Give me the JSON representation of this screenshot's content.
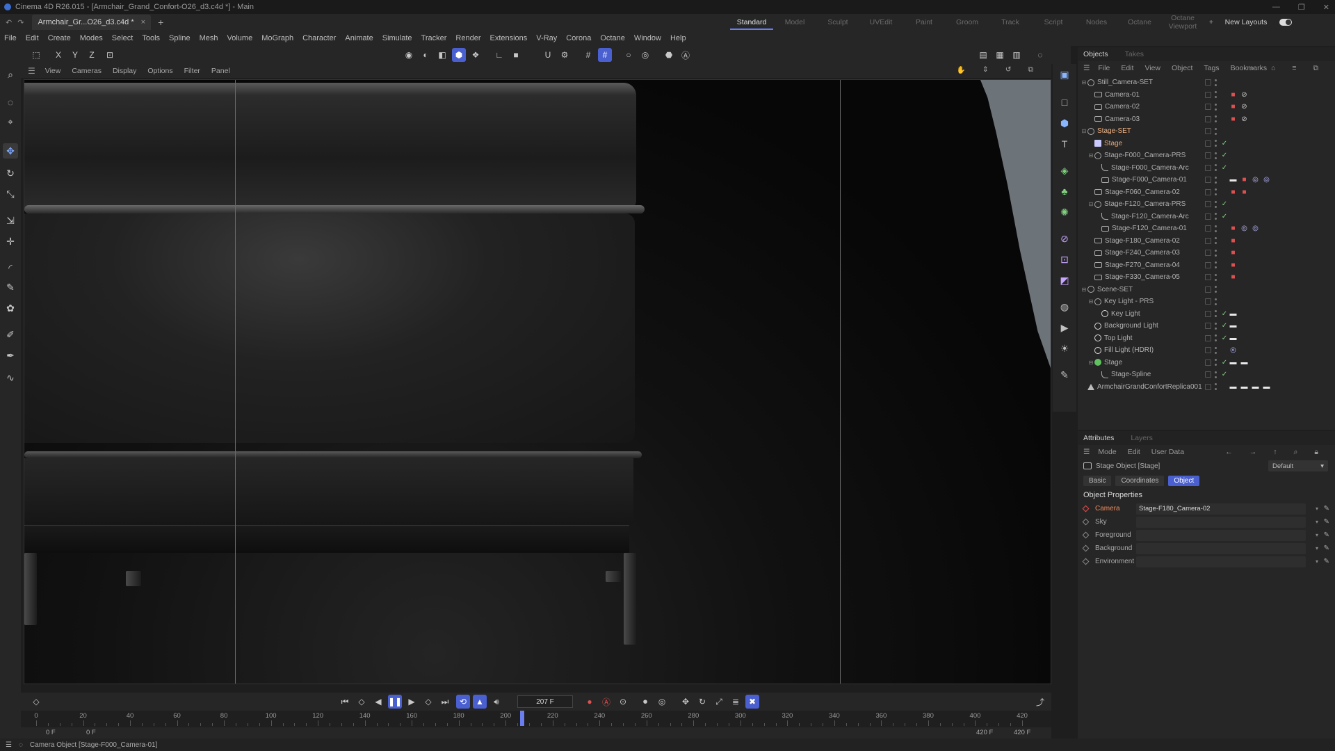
{
  "titlebar": {
    "title": "Cinema 4D R26.015 - [Armchair_Grand_Confort-O26_d3.c4d *] - Main",
    "controls": [
      "—",
      "❐",
      "✕"
    ]
  },
  "doc_tab": {
    "label": "Armchair_Gr...O26_d3.c4d *",
    "close": "×",
    "add": "+"
  },
  "layouts": {
    "items": [
      "Standard",
      "Model",
      "Sculpt",
      "UVEdit",
      "Paint",
      "Groom",
      "Track",
      "Script",
      "Nodes",
      "Octane",
      "Octane Viewport"
    ],
    "active": "Standard",
    "add": "+",
    "new_layouts": "New Layouts"
  },
  "menubar": [
    "File",
    "Edit",
    "Create",
    "Modes",
    "Select",
    "Tools",
    "Spline",
    "Mesh",
    "Volume",
    "MoGraph",
    "Character",
    "Animate",
    "Simulate",
    "Tracker",
    "Render",
    "Extensions",
    "V-Ray",
    "Corona",
    "Octane",
    "Window",
    "Help"
  ],
  "toolbar": {
    "axes": [
      "X",
      "Y",
      "Z"
    ]
  },
  "viewport_menu": [
    "View",
    "Cameras",
    "Display",
    "Options",
    "Filter",
    "Panel"
  ],
  "objects_panel": {
    "tabs": [
      "Objects",
      "Takes"
    ],
    "menu": [
      "File",
      "Edit",
      "View",
      "Object",
      "Tags",
      "Bookmarks"
    ],
    "rows": [
      {
        "label": "Still_Camera-SET",
        "icon": "null-icon",
        "indent": 0,
        "tw": "⊟",
        "check": false,
        "tags": []
      },
      {
        "label": "Camera-01",
        "icon": "camera-icon",
        "indent": 1,
        "tw": "",
        "check": false,
        "tags": [
          "rec",
          "no"
        ]
      },
      {
        "label": "Camera-02",
        "icon": "camera-icon",
        "indent": 1,
        "tw": "",
        "check": false,
        "tags": [
          "rec",
          "no"
        ]
      },
      {
        "label": "Camera-03",
        "icon": "camera-icon",
        "indent": 1,
        "tw": "",
        "check": false,
        "tags": [
          "rec",
          "no"
        ]
      },
      {
        "label": "Stage-SET",
        "icon": "null-icon",
        "indent": 0,
        "tw": "⊟",
        "check": false,
        "tags": [],
        "style": "hl"
      },
      {
        "label": "Stage",
        "icon": "stage-icon",
        "indent": 1,
        "tw": "",
        "check": true,
        "tags": [],
        "style": "sel"
      },
      {
        "label": "Stage-F000_Camera-PRS",
        "icon": "null-icon",
        "indent": 1,
        "tw": "⊟",
        "check": true,
        "tags": []
      },
      {
        "label": "Stage-F000_Camera-Arc",
        "icon": "spline-icon",
        "indent": 2,
        "tw": "",
        "check": true,
        "tags": []
      },
      {
        "label": "Stage-F000_Camera-01",
        "icon": "camera-icon",
        "indent": 2,
        "tw": "",
        "check": false,
        "tags": [
          "white",
          "rec",
          "target",
          "target"
        ]
      },
      {
        "label": "Stage-F060_Camera-02",
        "icon": "camera-icon",
        "indent": 1,
        "tw": "",
        "check": false,
        "tags": [
          "rec",
          "rec"
        ]
      },
      {
        "label": "Stage-F120_Camera-PRS",
        "icon": "null-icon",
        "indent": 1,
        "tw": "⊟",
        "check": true,
        "tags": []
      },
      {
        "label": "Stage-F120_Camera-Arc",
        "icon": "spline-icon",
        "indent": 2,
        "tw": "",
        "check": true,
        "tags": []
      },
      {
        "label": "Stage-F120_Camera-01",
        "icon": "camera-icon",
        "indent": 2,
        "tw": "",
        "check": false,
        "tags": [
          "rec",
          "target",
          "target"
        ]
      },
      {
        "label": "Stage-F180_Camera-02",
        "icon": "camera-icon",
        "indent": 1,
        "tw": "",
        "check": false,
        "tags": [
          "rec"
        ]
      },
      {
        "label": "Stage-F240_Camera-03",
        "icon": "camera-icon",
        "indent": 1,
        "tw": "",
        "check": false,
        "tags": [
          "rec"
        ]
      },
      {
        "label": "Stage-F270_Camera-04",
        "icon": "camera-icon",
        "indent": 1,
        "tw": "",
        "check": false,
        "tags": [
          "rec"
        ]
      },
      {
        "label": "Stage-F330_Camera-05",
        "icon": "camera-icon",
        "indent": 1,
        "tw": "",
        "check": false,
        "tags": [
          "rec"
        ]
      },
      {
        "label": "Scene-SET",
        "icon": "null-icon",
        "indent": 0,
        "tw": "⊟",
        "check": false,
        "tags": []
      },
      {
        "label": "Key Light - PRS",
        "icon": "null-icon",
        "indent": 1,
        "tw": "⊟",
        "check": false,
        "tags": []
      },
      {
        "label": "Key Light",
        "icon": "light-icon",
        "indent": 2,
        "tw": "",
        "check": true,
        "tags": [
          "white"
        ]
      },
      {
        "label": "Background Light",
        "icon": "light-icon",
        "indent": 1,
        "tw": "",
        "check": true,
        "tags": [
          "white"
        ]
      },
      {
        "label": "Top Light",
        "icon": "light-icon",
        "indent": 1,
        "tw": "",
        "check": true,
        "tags": [
          "white"
        ]
      },
      {
        "label": "Fill Light (HDRI)",
        "icon": "light-icon",
        "indent": 1,
        "tw": "",
        "check": false,
        "tags": [
          "target"
        ]
      },
      {
        "label": "Stage",
        "icon": "green-icon",
        "indent": 1,
        "tw": "⊟",
        "check": true,
        "tags": [
          "white",
          "white"
        ]
      },
      {
        "label": "Stage-Spline",
        "icon": "spline-icon",
        "indent": 2,
        "tw": "",
        "check": true,
        "tags": []
      },
      {
        "label": "ArmchairGrandConfortReplica001",
        "icon": "model-icon",
        "indent": 0,
        "tw": "",
        "check": false,
        "tags": [
          "white",
          "white",
          "white",
          "white"
        ]
      }
    ]
  },
  "attributes": {
    "tabs": [
      "Attributes",
      "Layers"
    ],
    "menu": [
      "Mode",
      "Edit",
      "User Data"
    ],
    "object_type": "Stage Object [Stage]",
    "preset": "Default",
    "sub_tabs": [
      "Basic",
      "Coordinates",
      "Object"
    ],
    "active_sub_tab": "Object",
    "section": "Object Properties",
    "props": [
      {
        "label": "Camera",
        "value": "Stage-F180_Camera-02",
        "highlight": true
      },
      {
        "label": "Sky",
        "value": ""
      },
      {
        "label": "Foreground",
        "value": ""
      },
      {
        "label": "Background",
        "value": ""
      },
      {
        "label": "Environment",
        "value": ""
      }
    ]
  },
  "timeline": {
    "current_frame": "207 F",
    "ruler_labels": [
      "0",
      "20",
      "40",
      "60",
      "80",
      "100",
      "120",
      "140",
      "160",
      "180",
      "200",
      "220",
      "240",
      "260",
      "280",
      "300",
      "320",
      "340",
      "360",
      "380",
      "400",
      "420"
    ],
    "range_start": "0 F",
    "range_start2": "0 F",
    "range_end": "420 F",
    "range_end2": "420 F",
    "playhead_frame": 207,
    "max_frame": 420
  },
  "status": {
    "text": "Camera Object [Stage-F000_Camera-01]"
  },
  "colors": {
    "accent": "#4a5fd0",
    "record": "#e05050",
    "check": "#7fd07f",
    "highlight": "#f08a5a"
  }
}
